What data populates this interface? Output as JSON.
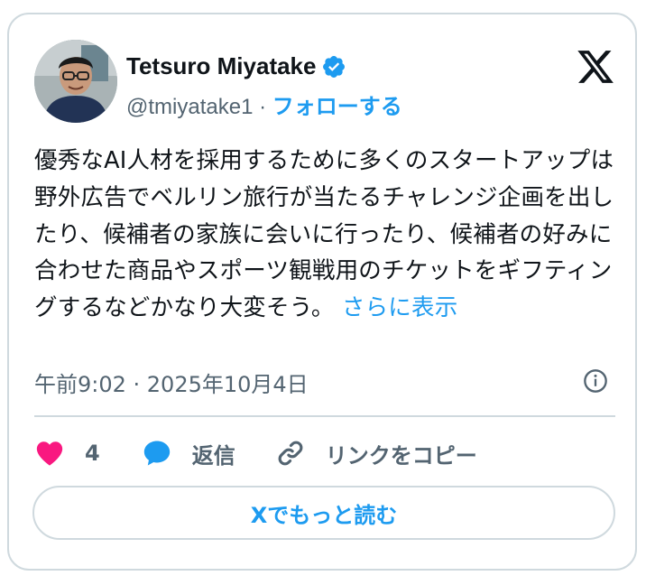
{
  "author": {
    "name": "Tetsuro Miyatake",
    "handle": "@tmiyatake1",
    "separator": "·",
    "follow_label": "フォローする"
  },
  "tweet": {
    "text": "優秀なAI人材を採用するために多くのスタートアップは野外広告でベルリン旅行が当たるチャレンジ企画を出したり、候補者の家族に会いに行ったり、候補者の好みに合わせた商品やスポーツ観戦用のチケットをギフティングするなどかなり大変そう。",
    "show_more": "さらに表示",
    "timestamp": "午前9:02 · 2025年10月4日"
  },
  "actions": {
    "like_count": "4",
    "reply_label": "返信",
    "copy_link_label": "リンクをコピー"
  },
  "read_more_button": "Xでもっと読む",
  "colors": {
    "accent": "#1d9bf0",
    "like": "#f91880",
    "text": "#0f1419",
    "secondary": "#536471",
    "border": "#cfd9de"
  },
  "icons": [
    "avatar",
    "verified-badge-icon",
    "x-logo-icon",
    "info-icon",
    "heart-icon",
    "reply-icon",
    "link-icon"
  ]
}
